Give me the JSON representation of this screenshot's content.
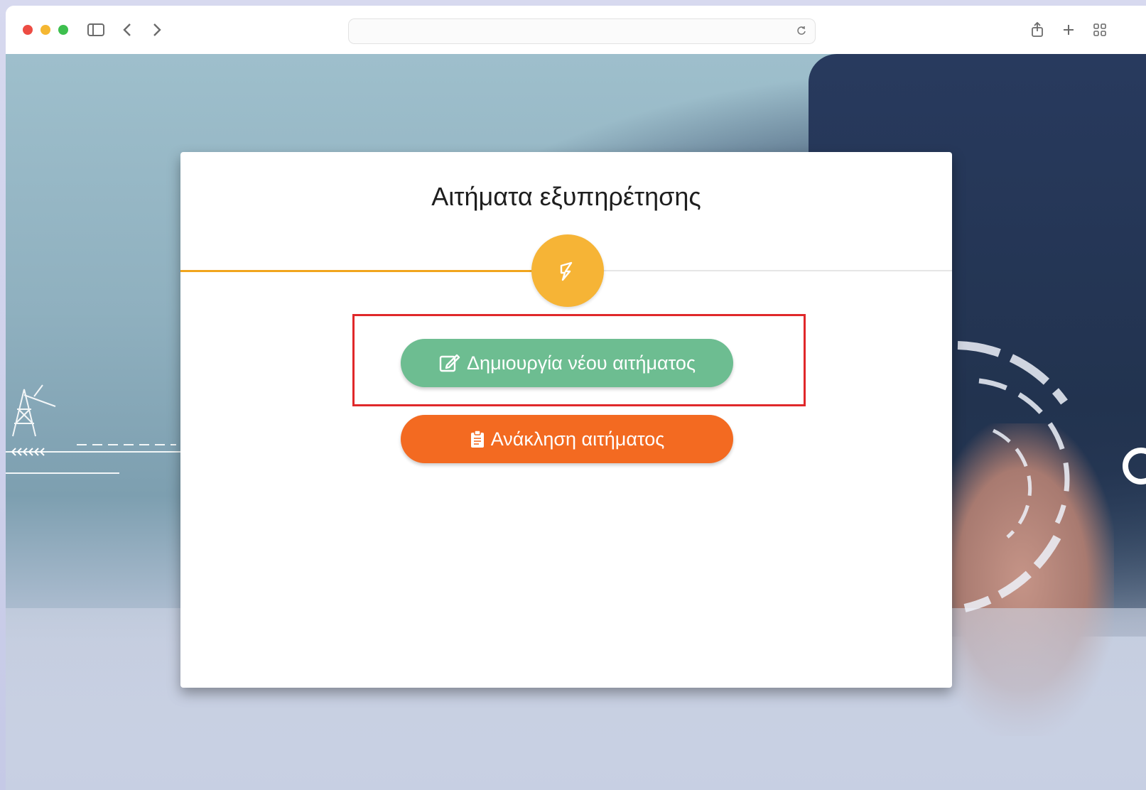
{
  "browser": {
    "address_value": ""
  },
  "card": {
    "title": "Αιτήματα εξυπηρέτησης",
    "create_button_label": "Δημιουργία νέου αιτήματος",
    "cancel_button_label": "Ανάκληση αιτήματος"
  },
  "colors": {
    "accent_yellow": "#f6b436",
    "create_green": "#6dbd91",
    "cancel_orange": "#f36a21",
    "highlight_red": "#e0282a"
  },
  "icons": {
    "logo": "lightning-icon",
    "create": "edit-icon",
    "cancel": "clipboard-icon"
  }
}
